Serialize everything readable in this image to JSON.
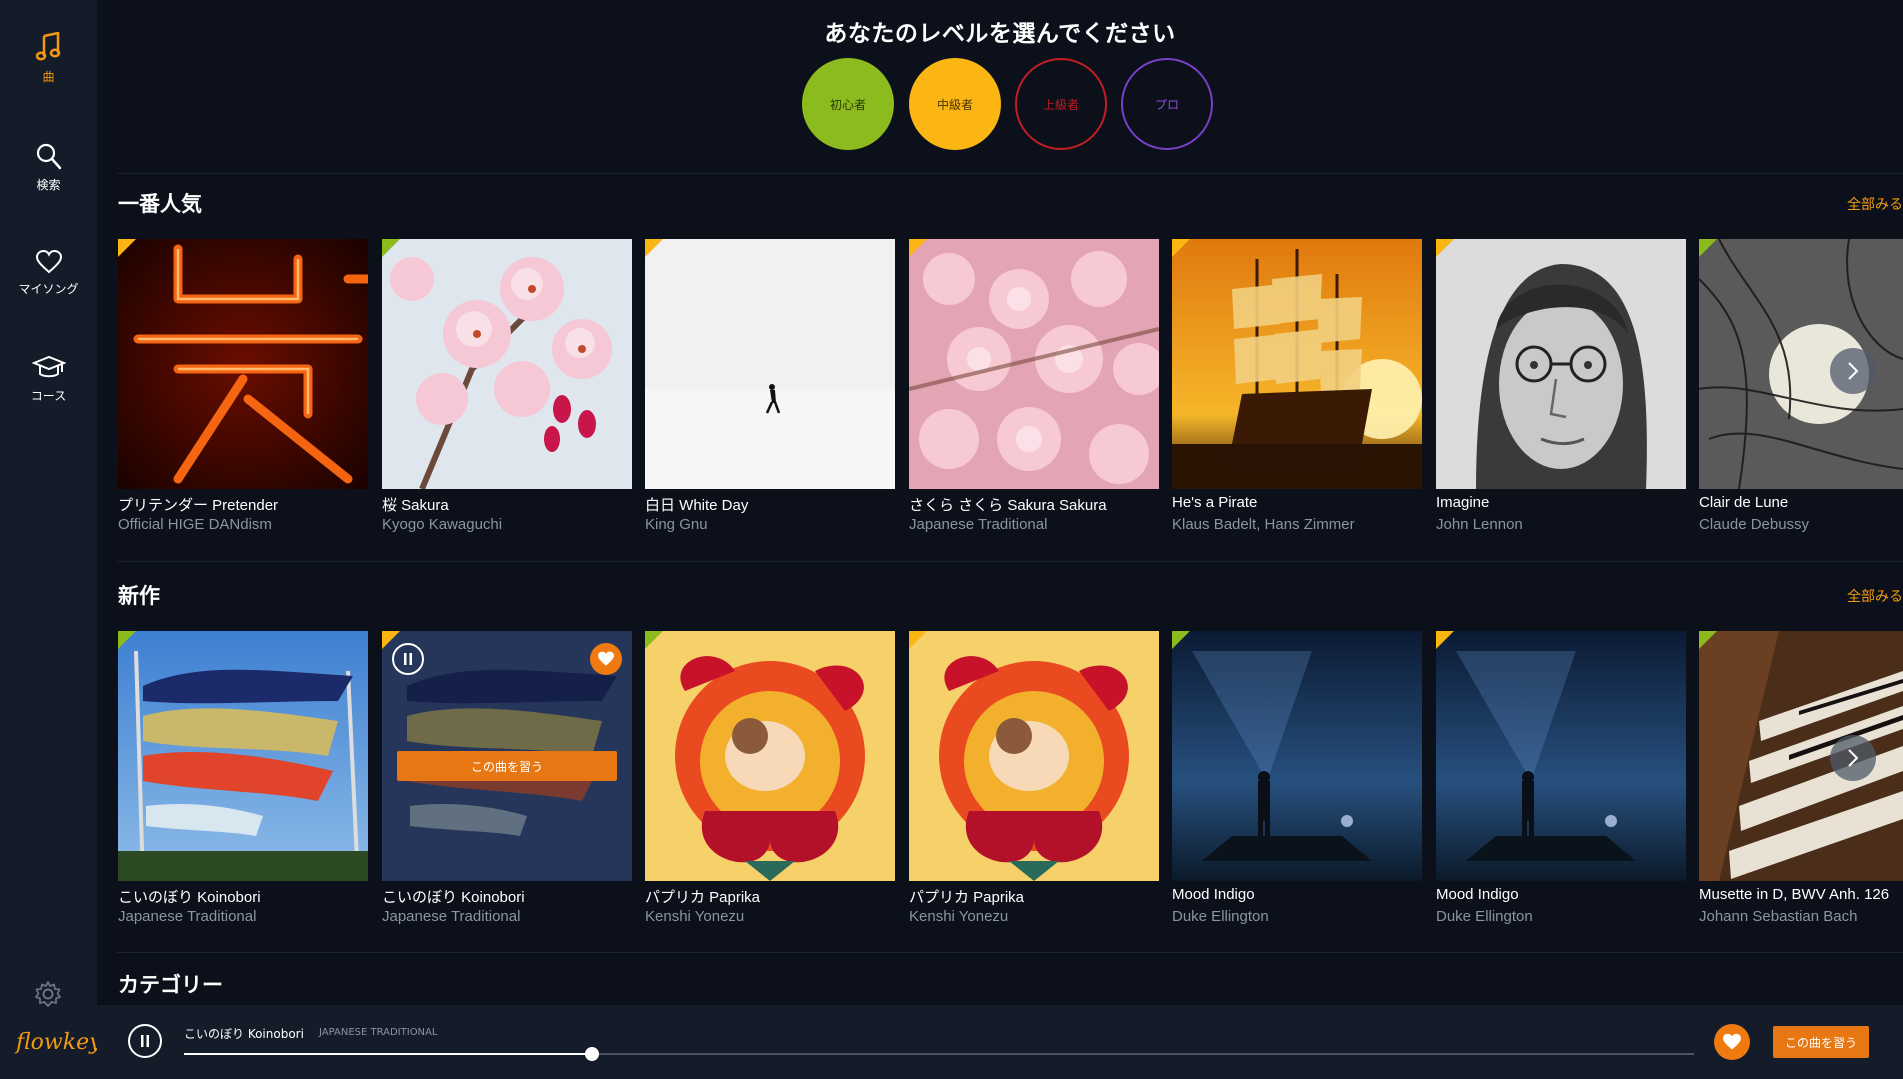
{
  "sidebar": {
    "items": [
      {
        "label": "曲",
        "icon": "music-note-icon"
      },
      {
        "label": "検索",
        "icon": "search-icon"
      },
      {
        "label": "マイソング",
        "icon": "heart-icon"
      },
      {
        "label": "コース",
        "icon": "graduation-cap-icon"
      }
    ],
    "logo": "flowkey"
  },
  "levels": {
    "title": "あなたのレベルを選んでください",
    "options": [
      "初心者",
      "中級者",
      "上級者",
      "プロ"
    ],
    "colors": {
      "beginner": "#8bbb1d",
      "intermediate": "#fbb613",
      "advanced": "#c21d23",
      "pro": "#7a3fc8"
    }
  },
  "popular": {
    "title": "一番人気",
    "see_all": "全部みる",
    "songs": [
      {
        "title": "プリテンダー Pretender",
        "artist": "Official HIGE DANdism",
        "level": "intermediate"
      },
      {
        "title": "桜 Sakura",
        "artist": "Kyogo Kawaguchi",
        "level": "beginner"
      },
      {
        "title": "白日 White Day",
        "artist": "King Gnu",
        "level": "intermediate"
      },
      {
        "title": "さくら さくら Sakura Sakura",
        "artist": "Japanese Traditional",
        "level": "intermediate"
      },
      {
        "title": "He's a Pirate",
        "artist": "Klaus Badelt, Hans Zimmer",
        "level": "intermediate"
      },
      {
        "title": "Imagine",
        "artist": "John Lennon",
        "level": "intermediate"
      },
      {
        "title": "Clair de Lune",
        "artist": "Claude Debussy",
        "level": "beginner"
      }
    ]
  },
  "new": {
    "title": "新作",
    "see_all": "全部みる",
    "hover_button": "この曲を習う",
    "songs": [
      {
        "title": "こいのぼり Koinobori",
        "artist": "Japanese Traditional",
        "level": "beginner"
      },
      {
        "title": "こいのぼり Koinobori",
        "artist": "Japanese Traditional",
        "level": "intermediate"
      },
      {
        "title": "パプリカ Paprika",
        "artist": "Kenshi Yonezu",
        "level": "beginner"
      },
      {
        "title": "パプリカ Paprika",
        "artist": "Kenshi Yonezu",
        "level": "intermediate"
      },
      {
        "title": "Mood Indigo",
        "artist": "Duke Ellington",
        "level": "beginner"
      },
      {
        "title": "Mood Indigo",
        "artist": "Duke Ellington",
        "level": "intermediate"
      },
      {
        "title": "Musette in D, BWV Anh. 126",
        "artist": "Johann Sebastian Bach",
        "level": "beginner"
      }
    ]
  },
  "categories": {
    "title": "カテゴリー"
  },
  "player": {
    "title": "こいのぼり Koinobori",
    "artist": "JAPANESE TRADITIONAL",
    "learn_button": "この曲を習う",
    "progress": 0.27
  }
}
